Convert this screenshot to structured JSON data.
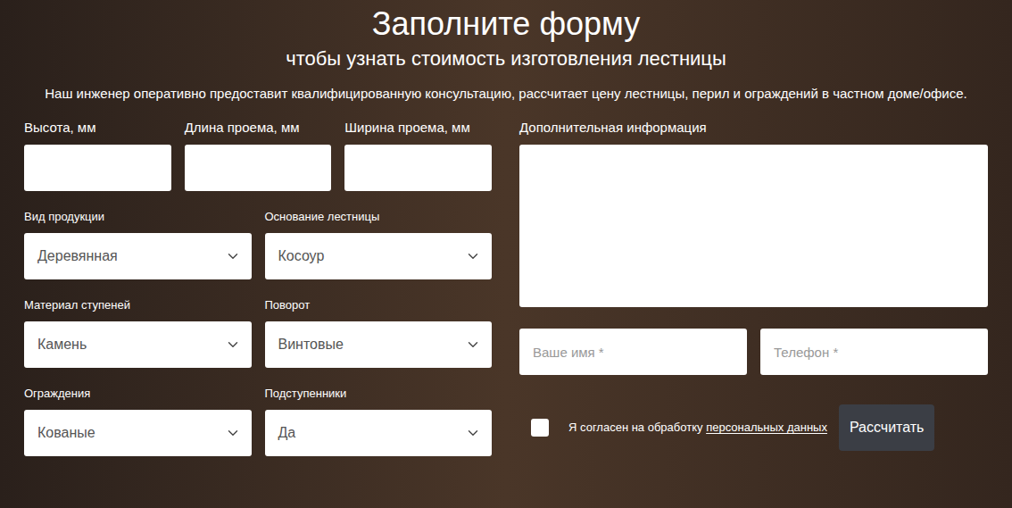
{
  "form": {
    "title": "Заполните форму",
    "subtitle": "чтобы узнать стоимость изготовления лестницы",
    "description": "Наш инженер оперативно предоставит квалифицированную консультацию, рассчитает цену лестницы, перил и ограждений в частном доме/офисе."
  },
  "dimension_fields": [
    {
      "label": "Высота, мм",
      "value": ""
    },
    {
      "label": "Длина проема, мм",
      "value": ""
    },
    {
      "label": "Ширина проема, мм",
      "value": ""
    }
  ],
  "selects": [
    {
      "label": "Вид продукции",
      "value": "Деревянная"
    },
    {
      "label": "Основание лестницы",
      "value": "Косоур"
    },
    {
      "label": "Материал ступеней",
      "value": "Камень"
    },
    {
      "label": "Поворот",
      "value": "Винтовые"
    },
    {
      "label": "Ограждения",
      "value": "Кованые"
    },
    {
      "label": "Подступенники",
      "value": "Да"
    }
  ],
  "extra_info": {
    "label": "Дополнительная информация",
    "value": ""
  },
  "name_field": {
    "placeholder": "Ваше имя *"
  },
  "phone_field": {
    "placeholder": "Телефон *"
  },
  "consent": {
    "checked": false,
    "text": "Я согласен на обработку",
    "link": "персональных данных"
  },
  "submit_button": "Рассчитать"
}
